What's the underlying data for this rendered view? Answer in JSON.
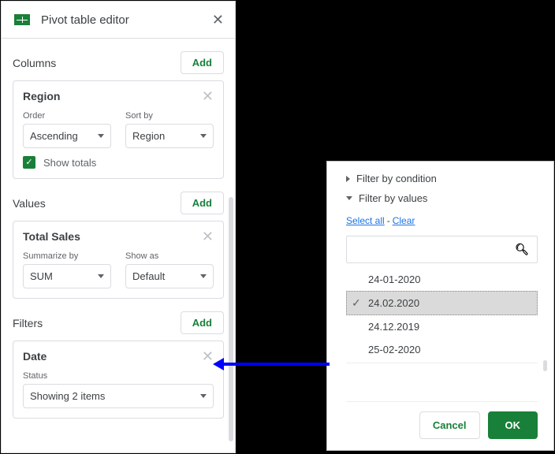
{
  "panel": {
    "title": "Pivot table editor",
    "columns": {
      "heading": "Columns",
      "add": "Add",
      "card_title": "Region",
      "order_label": "Order",
      "sort_label": "Sort by",
      "order_value": "Ascending",
      "sort_value": "Region",
      "show_totals": "Show totals"
    },
    "values": {
      "heading": "Values",
      "add": "Add",
      "card_title": "Total Sales",
      "summarize_label": "Summarize by",
      "showas_label": "Show as",
      "summarize_value": "SUM",
      "showas_value": "Default"
    },
    "filters": {
      "heading": "Filters",
      "add": "Add",
      "card_title": "Date",
      "status_label": "Status",
      "status_value": "Showing 2 items"
    }
  },
  "popup": {
    "by_condition": "Filter by condition",
    "by_values": "Filter by values",
    "select_all": "Select all",
    "clear": "Clear",
    "items": [
      "24-01-2020",
      "24.02.2020",
      "24.12.2019",
      "25-02-2020"
    ],
    "cancel": "Cancel",
    "ok": "OK"
  }
}
